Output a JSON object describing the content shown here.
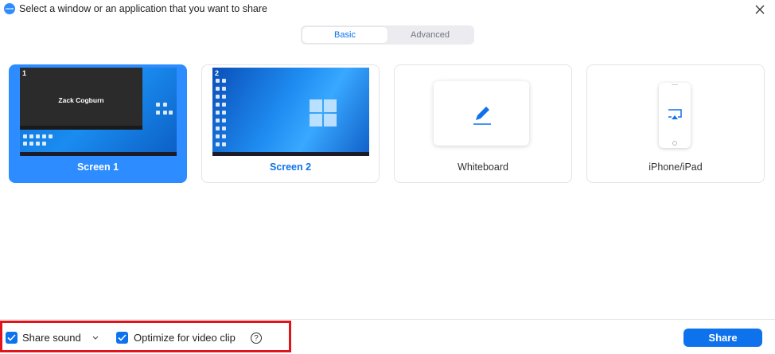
{
  "window": {
    "title": "Select a window or an application that you want to share",
    "logo_text": "zoom",
    "close_icon": "close-icon"
  },
  "tabs": [
    {
      "label": "Basic",
      "active": true
    },
    {
      "label": "Advanced",
      "active": false
    }
  ],
  "tiles": {
    "screen1": {
      "label": "Screen 1",
      "number": "1",
      "video_name": "Zack Cogburn",
      "selected": true
    },
    "screen2": {
      "label": "Screen 2",
      "number": "2",
      "selected": false
    },
    "whiteboard": {
      "label": "Whiteboard",
      "icon": "pen-icon"
    },
    "iphone": {
      "label": "iPhone/iPad",
      "icon": "airplay-icon"
    }
  },
  "footer": {
    "share_sound_label": "Share sound",
    "share_sound_checked": true,
    "optimize_label": "Optimize for video clip",
    "optimize_checked": true,
    "help_glyph": "?",
    "share_button": "Share"
  },
  "colors": {
    "accent": "#0e72ed",
    "selected_tile": "#2d8cff",
    "highlight_box": "#e0141c"
  }
}
